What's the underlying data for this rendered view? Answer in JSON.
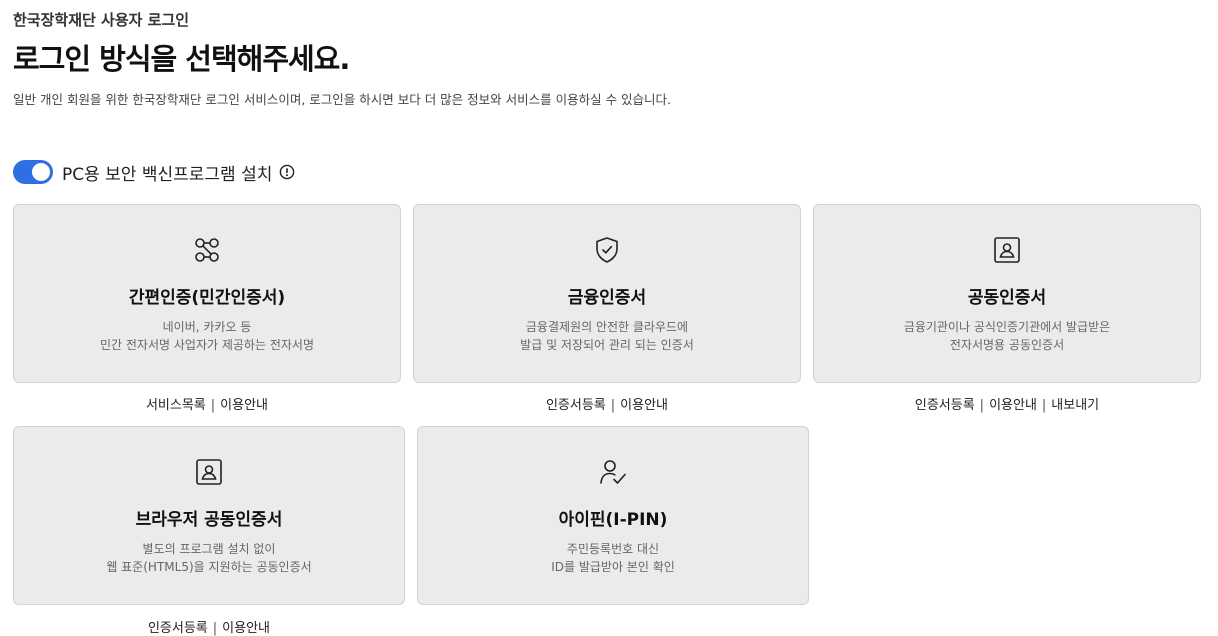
{
  "header": {
    "org": "한국장학재단 사용자 로그인",
    "title": "로그인 방식을 선택해주세요.",
    "description": "일반 개인 회원을 위한 한국장학재단 로그인 서비스이며, 로그인을 하시면 보다 더 많은 정보와 서비스를 이용하실 수 있습니다."
  },
  "security_toggle": {
    "label": "PC용 보안 백신프로그램 설치",
    "enabled": true,
    "accent_color": "#2f6fe4"
  },
  "cards": [
    {
      "icon": "link-nodes-icon",
      "name": "간편인증(민간인증서)",
      "line1": "네이버, 카카오 등",
      "line2": "민간 전자서명 사업자가 제공하는 전자서명",
      "links": [
        "서비스목록",
        "이용안내"
      ]
    },
    {
      "icon": "shield-check-icon",
      "name": "금융인증서",
      "line1": "금융결제원의 안전한 클라우드에",
      "line2": "발급 및 저장되어 관리 되는 인증서",
      "links": [
        "인증서등록",
        "이용안내"
      ]
    },
    {
      "icon": "id-card-icon",
      "name": "공동인증서",
      "line1": "금융기관이나 공식인증기관에서 발급받은",
      "line2": "전자서명용 공동인증서",
      "links": [
        "인증서등록",
        "이용안내",
        "내보내기"
      ]
    },
    {
      "icon": "id-card-icon",
      "name": "브라우저 공동인증서",
      "line1": "별도의 프로그램 설치 없이",
      "line2": "웹 표준(HTML5)을 지원하는 공동인증서",
      "links": [
        "인증서등록",
        "이용안내"
      ]
    },
    {
      "icon": "user-check-icon",
      "name": "아이핀(I-PIN)",
      "line1": "주민등록번호 대신",
      "line2": "ID를 발급받아 본인 확인",
      "links": []
    }
  ],
  "link_separator": "|"
}
